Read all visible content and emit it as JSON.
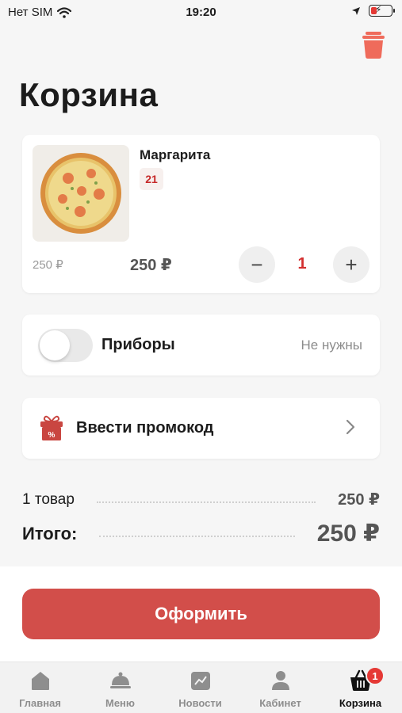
{
  "status_bar": {
    "carrier": "Нет SIM",
    "time": "19:20",
    "battery_level": 0.3
  },
  "page_title": "Корзина",
  "cart_item": {
    "name": "Маргарита",
    "badge": "21",
    "old_price": "250 ₽",
    "price": "250 ₽",
    "quantity": "1",
    "minus_label": "−",
    "plus_label": "+"
  },
  "cutlery": {
    "label": "Приборы",
    "value": "Не нужны",
    "enabled": false
  },
  "promo": {
    "label": "Ввести промокод"
  },
  "summary": {
    "items_label": "1 товар",
    "items_value": "250 ₽",
    "total_label": "Итого:",
    "total_value": "250 ₽"
  },
  "checkout_label": "Оформить",
  "tabs": [
    {
      "label": "Главная",
      "icon": "home-icon"
    },
    {
      "label": "Меню",
      "icon": "cloche-icon"
    },
    {
      "label": "Новости",
      "icon": "news-icon"
    },
    {
      "label": "Кабинет",
      "icon": "profile-icon"
    },
    {
      "label": "Корзина",
      "icon": "basket-icon",
      "active": true,
      "badge": "1"
    }
  ],
  "colors": {
    "accent": "#d24e4a",
    "badge_red": "#e53935",
    "trash": "#ef6b5b"
  }
}
